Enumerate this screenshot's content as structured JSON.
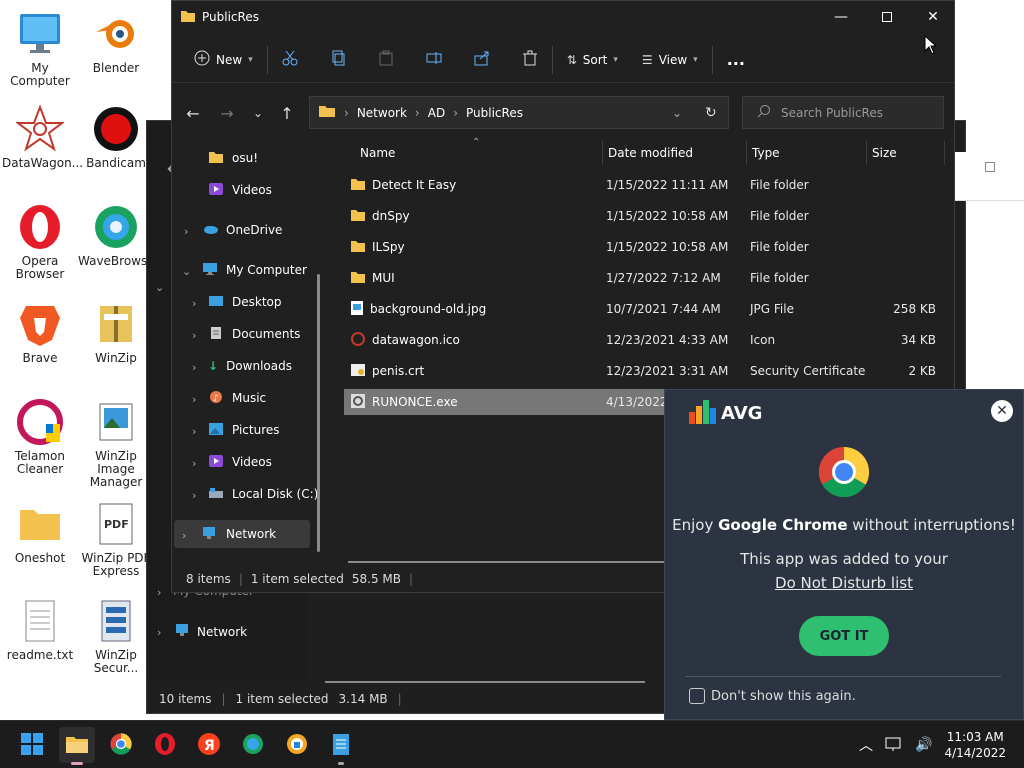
{
  "desktop_icons": [
    {
      "label": "My Computer"
    },
    {
      "label": "Blender"
    },
    {
      "label": "DataWagon..."
    },
    {
      "label": "Bandicam"
    },
    {
      "label": "Opera Browser"
    },
    {
      "label": "WaveBrowser"
    },
    {
      "label": "Brave"
    },
    {
      "label": "WinZip"
    },
    {
      "label": "Telamon Cleaner"
    },
    {
      "label": "WinZip Image Manager"
    },
    {
      "label": "Oneshot"
    },
    {
      "label": "WinZip PDF Express"
    },
    {
      "label": "readme.txt"
    },
    {
      "label": "WinZip Secur..."
    }
  ],
  "back_window": {
    "nav": {
      "my_computer": "My Computer",
      "network": "Network"
    },
    "status": {
      "items": "10 items",
      "selected": "1 item selected",
      "size": "3.14 MB"
    }
  },
  "window": {
    "title": "PublicRes",
    "toolbar": {
      "new": "New",
      "sort": "Sort",
      "view": "View",
      "more": "..."
    },
    "address": {
      "segments": [
        "Network",
        "AD",
        "PublicRes"
      ]
    },
    "search": {
      "placeholder": "Search PublicRes"
    },
    "nav": {
      "items": [
        {
          "label": "osu!"
        },
        {
          "label": "Videos"
        },
        {
          "label": "OneDrive"
        },
        {
          "label": "My Computer"
        },
        {
          "label": "Desktop"
        },
        {
          "label": "Documents"
        },
        {
          "label": "Downloads"
        },
        {
          "label": "Music"
        },
        {
          "label": "Pictures"
        },
        {
          "label": "Videos"
        },
        {
          "label": "Local Disk (C:)"
        },
        {
          "label": "Network"
        }
      ]
    },
    "columns": {
      "name": "Name",
      "date": "Date modified",
      "type": "Type",
      "size": "Size"
    },
    "files": [
      {
        "name": "Detect It Easy",
        "date": "1/15/2022 11:11 AM",
        "type": "File folder",
        "size": "",
        "kind": "folder"
      },
      {
        "name": "dnSpy",
        "date": "1/15/2022 10:58 AM",
        "type": "File folder",
        "size": "",
        "kind": "folder"
      },
      {
        "name": "ILSpy",
        "date": "1/15/2022 10:58 AM",
        "type": "File folder",
        "size": "",
        "kind": "folder"
      },
      {
        "name": "MUI",
        "date": "1/27/2022 7:12 AM",
        "type": "File folder",
        "size": "",
        "kind": "folder"
      },
      {
        "name": "background-old.jpg",
        "date": "10/7/2021 7:44 AM",
        "type": "JPG File",
        "size": "258 KB",
        "kind": "jpg"
      },
      {
        "name": "datawagon.ico",
        "date": "12/23/2021 4:33 AM",
        "type": "Icon",
        "size": "34 KB",
        "kind": "ico"
      },
      {
        "name": "penis.crt",
        "date": "12/23/2021 3:31 AM",
        "type": "Security Certificate",
        "size": "2 KB",
        "kind": "crt"
      },
      {
        "name": "RUNONCE.exe",
        "date": "4/13/2022",
        "type": "",
        "size": "",
        "kind": "exe"
      }
    ],
    "status": {
      "items": "8 items",
      "selected": "1 item selected",
      "size": "58.5 MB"
    }
  },
  "avg_popup": {
    "brand": "AVG",
    "headline_pre": "Enjoy ",
    "headline_bold": "Google Chrome",
    "headline_post": " without interruptions!",
    "line2": "This app was added to your",
    "link": "Do Not Disturb list",
    "button": "GOT IT",
    "checkbox": "Don't show this again."
  },
  "taskbar": {
    "clock_time": "11:03 AM",
    "clock_date": "4/14/2022"
  },
  "colors": {
    "accent": "#0078d4",
    "folder": "#f2c14e",
    "avg_green": "#2fbf71"
  }
}
